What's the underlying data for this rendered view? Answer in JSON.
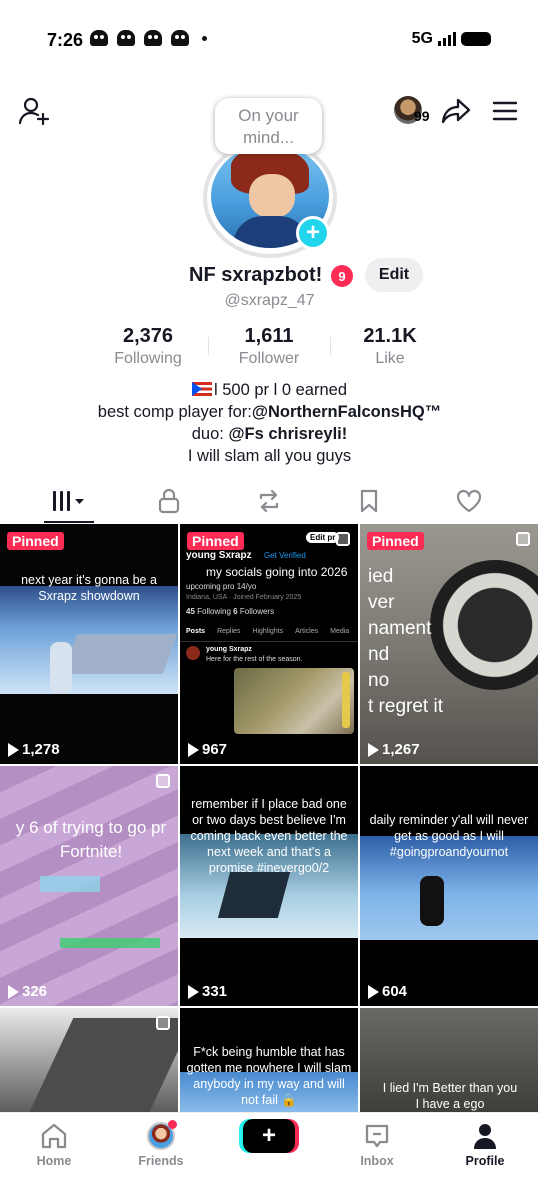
{
  "status_bar": {
    "time": "7:26",
    "network": "5G"
  },
  "header": {
    "thought_bubble": "On your mind...",
    "viewer_count": "99"
  },
  "profile": {
    "display_name": "NF sxrapzbot!",
    "badge_count": "9",
    "edit_label": "Edit",
    "handle": "@sxrapz_47"
  },
  "stats": [
    {
      "value": "2,376",
      "label": "Following"
    },
    {
      "value": "1,611",
      "label": "Follower"
    },
    {
      "value": "21.1K",
      "label": "Like"
    }
  ],
  "bio": {
    "line1": "l 500 pr l 0 earned",
    "line2_prefix": "best comp player for:",
    "line2_mention": "@NorthernFalconsHQ™",
    "line3_prefix": "duo: ",
    "line3_mention": "@Fs chrisreyli!",
    "line4": "I will slam all you guys"
  },
  "tabs": [
    "videos-tab",
    "private-tab",
    "reposts-tab",
    "favorites-tab",
    "liked-tab"
  ],
  "videos": [
    {
      "pinned": "Pinned",
      "caption": "next year it's gonna be a Sxrapz showdown",
      "views": "1,278"
    },
    {
      "pinned": "Pinned",
      "caption": "my socials going into 2026",
      "views": "967",
      "inner": {
        "name": "young Sxrapz",
        "verify": "Get Verified",
        "edit": "Edit pr",
        "bio": "upcoming pro 14/yo",
        "location": "Indiana, USA",
        "joined": "Joined February 2025",
        "following_count": "45",
        "following_label": "Following",
        "followers_count": "6",
        "followers_label": "Followers",
        "tabs": [
          "Posts",
          "Replies",
          "Highlights",
          "Articles",
          "Media"
        ],
        "post_text": "Here for the rest of the season."
      }
    },
    {
      "pinned": "Pinned",
      "caption_lines": [
        "ied",
        "ver",
        "nament",
        "nd",
        "no",
        "t regret it"
      ],
      "views": "1,267"
    },
    {
      "caption": "y 6 of trying to go pr Fortnite!",
      "views": "326"
    },
    {
      "caption": "remember if I place bad one or two days best believe I'm coming back even better the next week and that's a promise #inevergo0/2",
      "views": "331"
    },
    {
      "caption": "daily reminder y'all will never get as good as I will #goingproandyournot",
      "views": "604"
    },
    {
      "caption": "",
      "views": ""
    },
    {
      "caption": "F*ck being humble that has gotten me nowhere I will slam anybody in my way and will not fail 🔒",
      "views": ""
    },
    {
      "caption": "I lied I'm Better than you I have a ego",
      "views": ""
    }
  ],
  "bottom_nav": [
    {
      "label": "Home"
    },
    {
      "label": "Friends"
    },
    {
      "label": "+"
    },
    {
      "label": "Inbox"
    },
    {
      "label": "Profile"
    }
  ],
  "colors": {
    "accent_red": "#fe2c55",
    "accent_cyan": "#20d5ec",
    "text_primary": "#161823",
    "text_secondary": "#8a8b91"
  }
}
